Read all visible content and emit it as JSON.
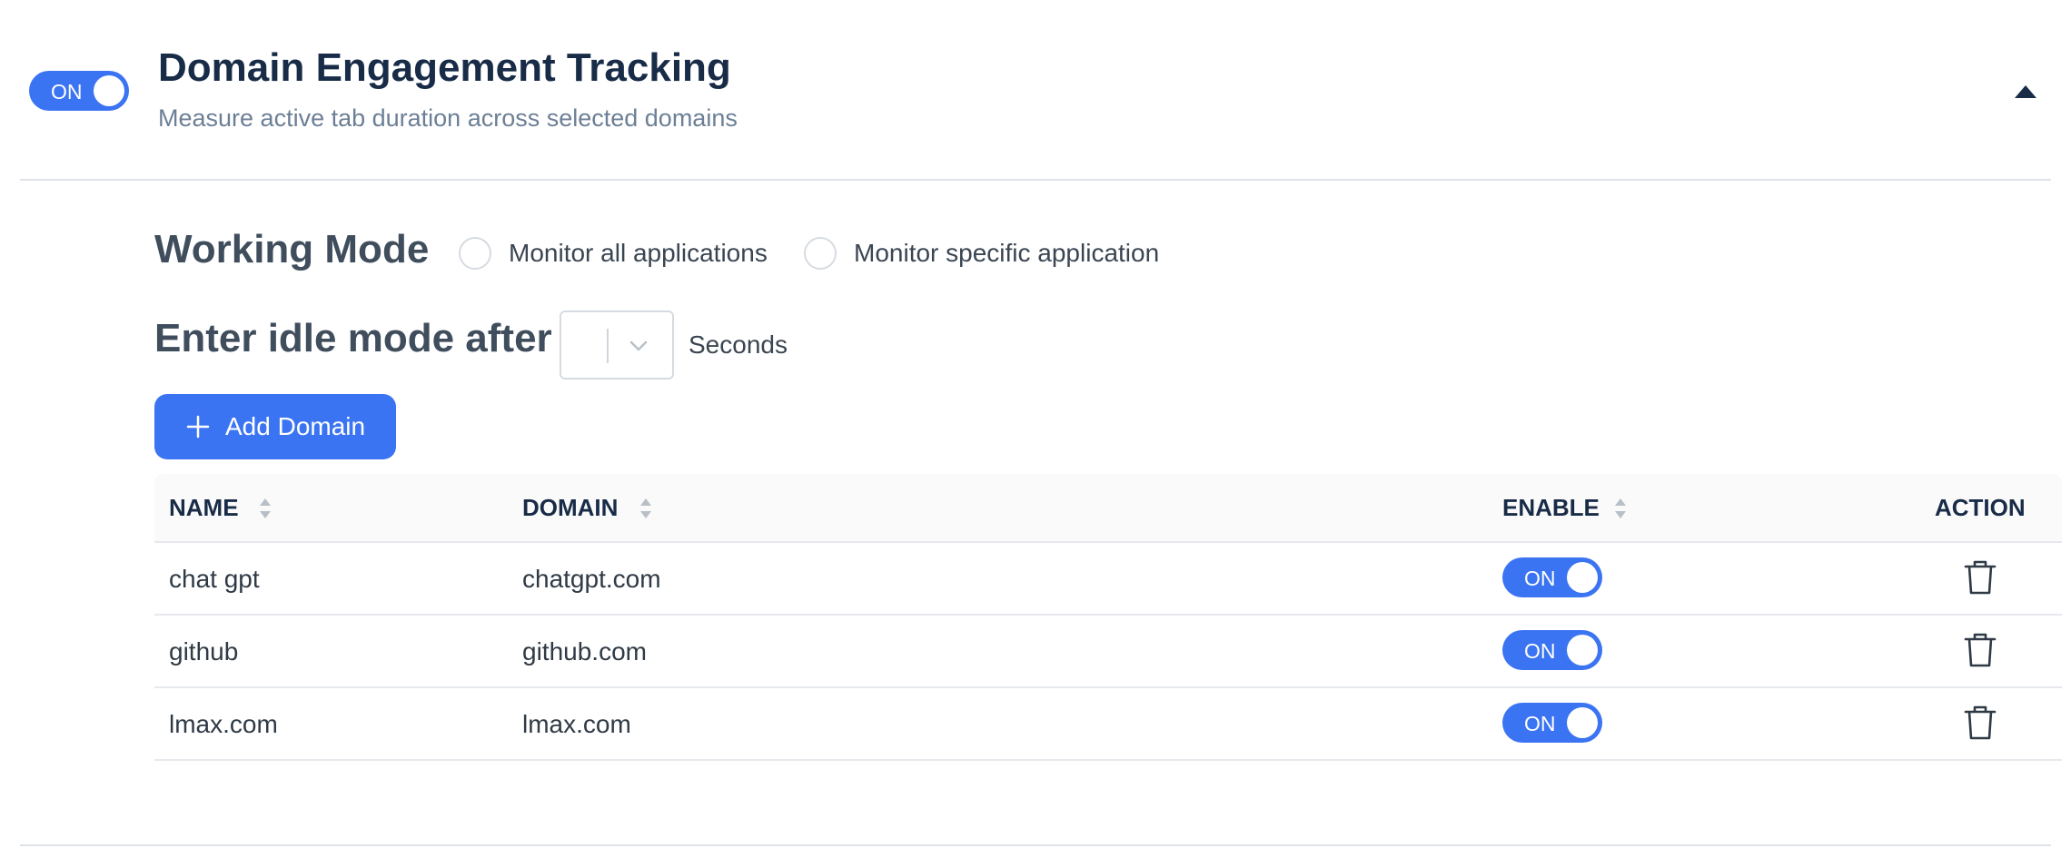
{
  "header": {
    "toggle_label": "ON",
    "title": "Domain Engagement Tracking",
    "subtitle": "Measure active tab duration across selected domains",
    "collapse_icon": "caret-up-icon"
  },
  "working_mode": {
    "label": "Working Mode",
    "options": [
      "Monitor all applications",
      "Monitor specific application"
    ],
    "selected": null
  },
  "idle": {
    "label": "Enter idle mode after",
    "value": "",
    "unit": "Seconds"
  },
  "add_button": {
    "label": "Add Domain",
    "icon": "plus-icon"
  },
  "table": {
    "columns": [
      "NAME",
      "DOMAIN",
      "ENABLE",
      "ACTION"
    ],
    "rows": [
      {
        "name": "chat gpt",
        "domain": "chatgpt.com",
        "enable": "ON"
      },
      {
        "name": "github",
        "domain": "github.com",
        "enable": "ON"
      },
      {
        "name": "lmax.com",
        "domain": "lmax.com",
        "enable": "ON"
      }
    ],
    "action_icon": "trash-icon"
  },
  "colors": {
    "accent": "#3b74f2",
    "title": "#182b47",
    "subtitle": "#6c7f96",
    "divider": "#dfe3e8"
  }
}
